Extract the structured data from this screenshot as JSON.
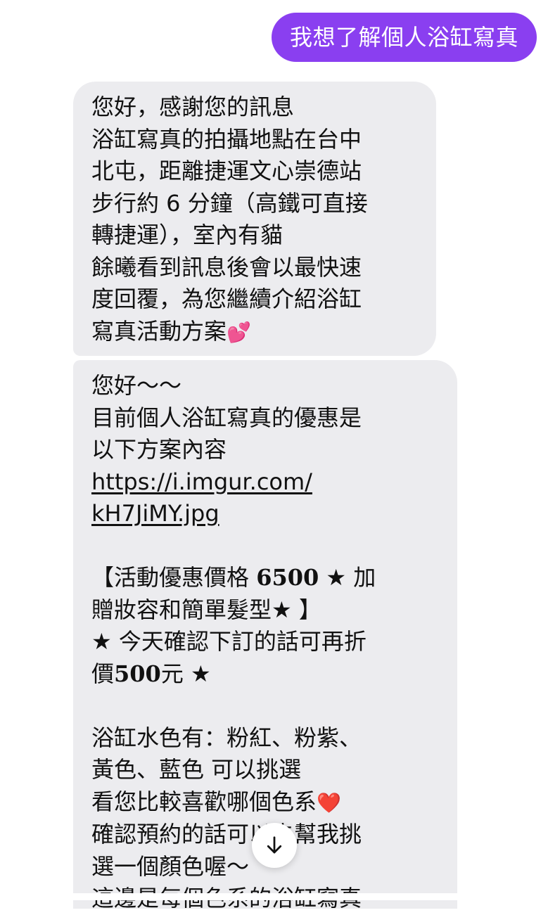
{
  "outgoing_message": "我想了解個人浴缸寫真",
  "reply_1": {
    "lines": [
      "您好，感謝您的訊息",
      "浴缸寫真的拍攝地點在台中",
      "北屯，距離捷運文心崇德站",
      "步行約 6 分鐘（高鐵可直接",
      "轉捷運），室內有貓",
      "餘曦看到訊息後會以最快速",
      "度回覆，為您繼續介紹浴缸",
      "寫真活動方案"
    ],
    "trailing_emoji": "💕"
  },
  "reply_2": {
    "line_1": "您好～～",
    "line_2": "目前個人浴缸寫真的優惠是",
    "line_3": "以下方案內容",
    "link_part_1": "https://i.imgur.com/",
    "link_part_2": "kH7JiMY.jpg",
    "promo_line_1_prefix": "【活動優惠價格 ",
    "promo_price": "6500",
    "promo_line_1_suffix": " ★ 加",
    "promo_line_2": "贈妝容和簡單髮型★ 】",
    "promo_line_3": "★ 今天確認下訂的話可再折",
    "promo_line_4_prefix": "價",
    "promo_discount": "500",
    "promo_line_4_suffix": "元 ★",
    "color_line_1": "浴缸水色有：粉紅、粉紫、",
    "color_line_2": "黃色、藍色 可以挑選",
    "color_line_3": "看您比較喜歡哪個色系",
    "color_line_3_emoji": "❤️",
    "color_line_4": "確認預約的話可以先幫我挑",
    "color_line_5": "選一個顏色喔～",
    "color_line_6": "這邊是每個色系的浴缸寫真"
  },
  "icons": {
    "scroll_down": "arrow-down-icon"
  },
  "colors": {
    "outgoing_bubble": "#8a3ff0",
    "incoming_bubble": "#ececef"
  }
}
